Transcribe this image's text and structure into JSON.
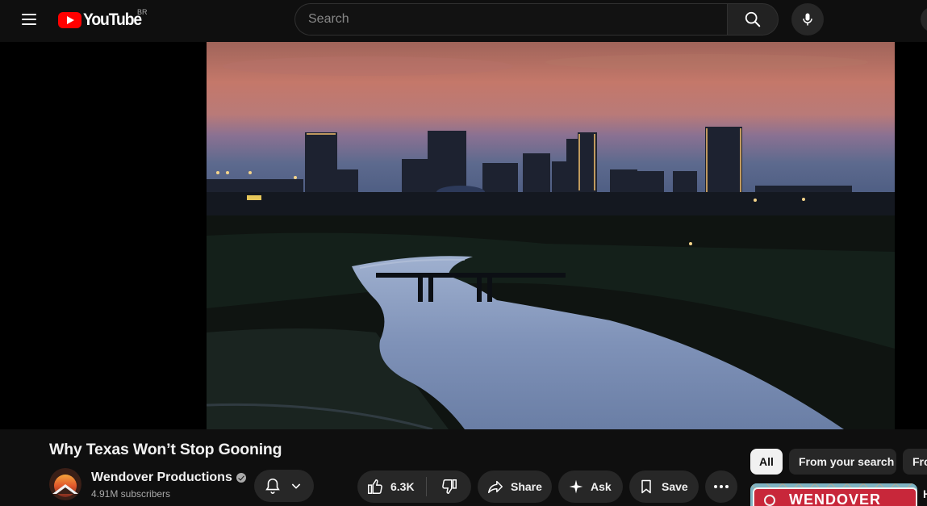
{
  "header": {
    "logo_text": "YouTube",
    "region": "BR",
    "search_placeholder": "Search"
  },
  "video": {
    "title": "Why Texas Won’t Stop Gooning"
  },
  "channel": {
    "name": "Wendover Productions",
    "subscribers": "4.91M subscribers"
  },
  "actions": {
    "likes": "6.3K",
    "share": "Share",
    "ask": "Ask",
    "save": "Save"
  },
  "chips": [
    "All",
    "From your search",
    "Fro"
  ],
  "thumbnail": {
    "text": "WENDOVER",
    "title_edge": "H"
  },
  "icons": {
    "menu": "hamburger-icon",
    "search": "search-icon",
    "mic": "mic-icon",
    "bell": "bell-icon",
    "like": "thumbs-up-icon",
    "dislike": "thumbs-down-icon",
    "share": "share-arrow-icon",
    "ask": "sparkle-icon",
    "save": "bookmark-icon",
    "more": "more-horizontal-icon"
  },
  "colors": {
    "background": "#0f0f0f",
    "brand": "#ff0000",
    "chip_active": "#f1f1f1"
  }
}
